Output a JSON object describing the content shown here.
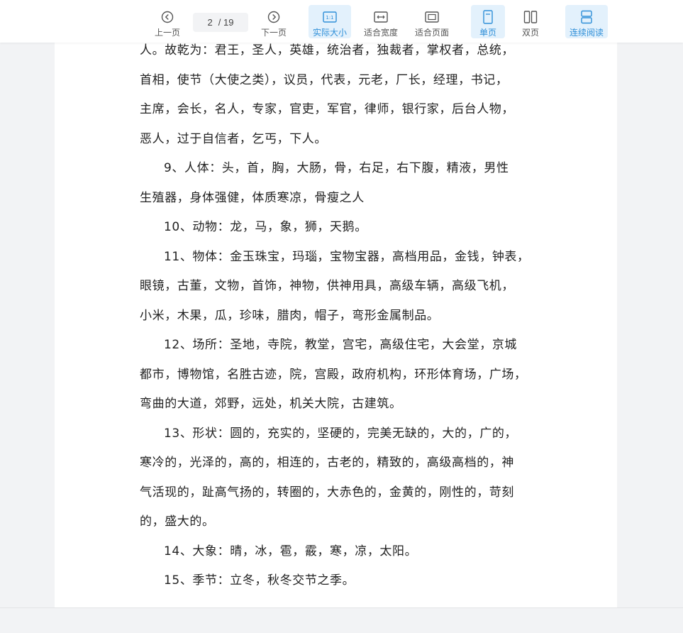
{
  "toolbar": {
    "prev_label": "上一页",
    "next_label": "下一页",
    "current_page": "2",
    "total_pages": "/ 19",
    "actual_size_label": "实际大小",
    "fit_width_label": "适合宽度",
    "fit_page_label": "适合页面",
    "single_page_label": "单页",
    "double_page_label": "双页",
    "continuous_label": "连续阅读",
    "accent_color": "#2f8fd8",
    "active_bg": "#e3f1fc"
  },
  "document": {
    "lines": [
      "人。故乾为：君王，圣人，英雄，统治者，独裁者，掌权者，总统，",
      "首相，使节（大使之类），议员，代表，元老，厂长，经理，书记，",
      "主席，会长，名人，专家，官吏，军官，律师，银行家，后台人物，",
      "恶人，过于自信者，乞丐，下人。"
    ],
    "paragraphs": [
      {
        "lines": [
          "9、人体：头，首，胸，大肠，骨，右足，右下腹，精液，男性",
          "生殖器，身体强健，体质寒凉，骨瘦之人"
        ]
      },
      {
        "lines": [
          "10、动物：龙，马，象，狮，天鹅。"
        ]
      },
      {
        "lines": [
          "11、物体：金玉珠宝，玛瑙，宝物宝器，高档用品，金钱，钟表，",
          "眼镜，古董，文物，首饰，神物，供神用具，高级车辆，高级飞机，",
          "小米，木果，瓜，珍味，腊肉，帽子，弯形金属制品。"
        ]
      },
      {
        "lines": [
          "12、场所：圣地，寺院，教堂，宫宅，高级住宅，大会堂，京城",
          "都市，博物馆，名胜古迹，院，宫殿，政府机构，环形体育场，广场，",
          "弯曲的大道，郊野，远处，机关大院，古建筑。"
        ]
      },
      {
        "lines": [
          "13、形状：圆的，充实的，坚硬的，完美无缺的，大的，广的，",
          "寒冷的，光泽的，高的，相连的，古老的，精致的，高级高档的，神",
          "气活现的，趾高气扬的，转圈的，大赤色的，金黄的，刚性的，苛刻",
          "的，盛大的。"
        ]
      },
      {
        "lines": [
          "14、大象：晴，冰，雹，霰，寒，凉，太阳。"
        ]
      },
      {
        "lines": [
          "15、季节：立冬，秋冬交节之季。"
        ]
      }
    ]
  }
}
